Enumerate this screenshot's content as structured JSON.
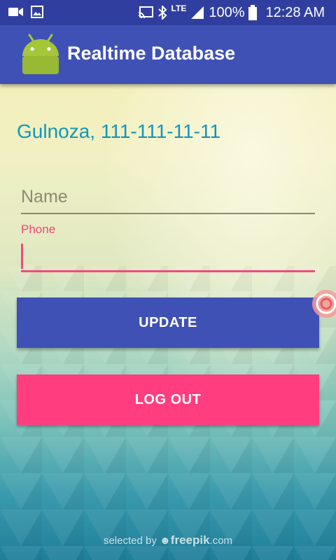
{
  "status_bar": {
    "network_type": "LTE",
    "battery_percent": "100%",
    "time": "12:28 AM",
    "icons": [
      "video-icon",
      "image-icon",
      "cast-icon",
      "bluetooth-icon",
      "signal-icon",
      "battery-icon"
    ]
  },
  "app_bar": {
    "title": "Realtime Database",
    "logo_icon": "android-icon"
  },
  "content": {
    "user_info": "Gulnoza, 111-111-11-11",
    "name_field": {
      "placeholder": "Name",
      "value": ""
    },
    "phone_field": {
      "label": "Phone",
      "value": ""
    },
    "update_button": "UPDATE",
    "logout_button": "LOG OUT"
  },
  "watermark": {
    "prefix": "selected by",
    "brand": "freepik",
    "suffix": ".com"
  },
  "colors": {
    "status_bar": "#303f9f",
    "app_bar": "#3f51b5",
    "accent": "#ff3d7f",
    "user_info_text": "#1296b8"
  }
}
